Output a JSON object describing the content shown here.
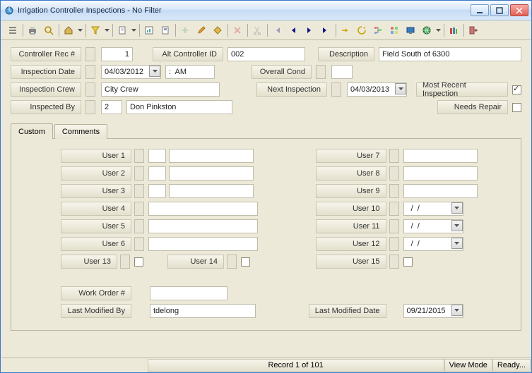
{
  "window": {
    "title": "Irrigation Controller Inspections - No Filter"
  },
  "labels": {
    "controller_rec": "Controller Rec #",
    "alt_controller_id": "Alt Controller ID",
    "description": "Description",
    "inspection_date": "Inspection Date",
    "overall_cond": "Overall Cond",
    "inspection_crew": "Inspection Crew",
    "next_inspection": "Next Inspection",
    "most_recent": "Most Recent Inspection",
    "inspected_by": "Inspected By",
    "needs_repair": "Needs Repair",
    "work_order": "Work Order #",
    "last_modified_by": "Last Modified By",
    "last_modified_date": "Last Modified Date"
  },
  "values": {
    "controller_rec": "1",
    "alt_controller_id": "002",
    "description": "Field South of 6300",
    "inspection_date": "04/03/2012",
    "inspection_time": ":  AM",
    "overall_cond": "",
    "inspection_crew": "City Crew",
    "next_inspection": "04/03/2013",
    "inspected_by_no": "2",
    "inspected_by_name": "Don Pinkston",
    "most_recent_checked": true,
    "needs_repair_checked": false,
    "work_order": "",
    "last_modified_by": "tdelong",
    "last_modified_date": "09/21/2015"
  },
  "tabs": {
    "custom": "Custom",
    "comments": "Comments",
    "active": "custom"
  },
  "user_fields": {
    "u1": "User 1",
    "u2": "User 2",
    "u3": "User 3",
    "u4": "User 4",
    "u5": "User 5",
    "u6": "User 6",
    "u7": "User 7",
    "u8": "User 8",
    "u9": "User 9",
    "u10": "User 10",
    "u11": "User 11",
    "u12": "User 12",
    "u13": "User 13",
    "u14": "User 14",
    "u15": "User 15",
    "date_placeholder": "  /  /"
  },
  "status": {
    "record": "Record 1 of 101",
    "mode": "View Mode",
    "ready": "Ready..."
  }
}
